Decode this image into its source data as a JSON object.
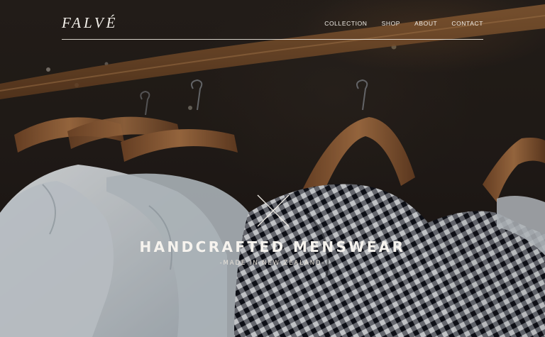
{
  "brand": {
    "logo": "FALVÉ"
  },
  "nav": {
    "items": [
      "COLLECTION",
      "SHOP",
      "ABOUT",
      "CONTACT"
    ]
  },
  "hero": {
    "headline": "HANDCRAFTED MENSWEAR",
    "subline": "-MADE IN NEW ZEALAND-",
    "emblem_icon": "crossed-lines-icon"
  },
  "colors": {
    "text": "#f2efe9",
    "background_dark": "#1f1a17",
    "wood": "#8a5a34",
    "shirt_white": "#e6ecf0",
    "gingham_dark": "#1e2230"
  }
}
